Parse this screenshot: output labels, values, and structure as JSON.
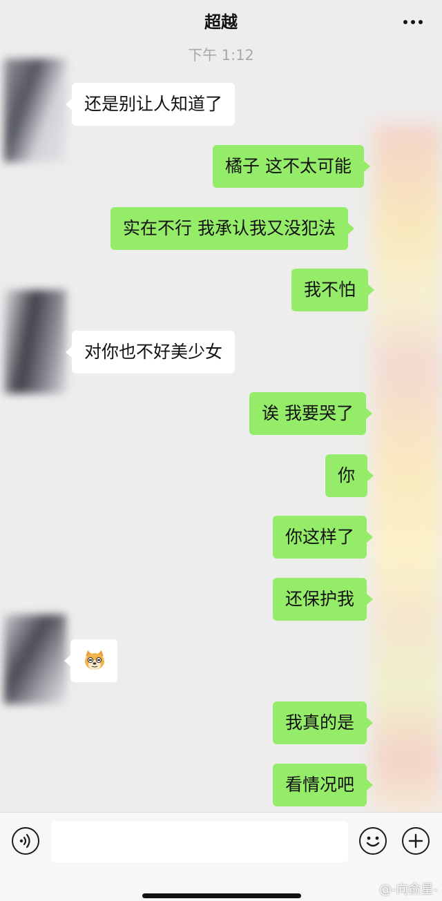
{
  "header": {
    "title": "超越",
    "more_icon": "more-dots-icon"
  },
  "chat": {
    "timestamp": "下午 1:12",
    "messages": [
      {
        "side": "in",
        "text": "还是别让人知道了"
      },
      {
        "side": "out",
        "text": "橘子 这不太可能"
      },
      {
        "side": "out",
        "text": "实在不行 我承认我又没犯法"
      },
      {
        "side": "out",
        "text": "我不怕"
      },
      {
        "side": "in",
        "text": "对你也不好美少女"
      },
      {
        "side": "out",
        "text": "诶 我要哭了"
      },
      {
        "side": "out",
        "text": "你"
      },
      {
        "side": "out",
        "text": "你这样了"
      },
      {
        "side": "out",
        "text": "还保护我"
      },
      {
        "side": "in",
        "sticker": "doge-emoji"
      },
      {
        "side": "out",
        "text": "我真的是"
      },
      {
        "side": "out",
        "text": "看情况吧"
      }
    ]
  },
  "input_bar": {
    "voice_icon": "voice-icon",
    "emoji_icon": "emoji-smile-icon",
    "plus_icon": "plus-icon",
    "text_value": ""
  },
  "watermark": "@-向俞星-",
  "colors": {
    "background": "#ededed",
    "outgoing_bubble": "#95ec69",
    "incoming_bubble": "#ffffff",
    "timestamp": "#a8a8a8"
  }
}
